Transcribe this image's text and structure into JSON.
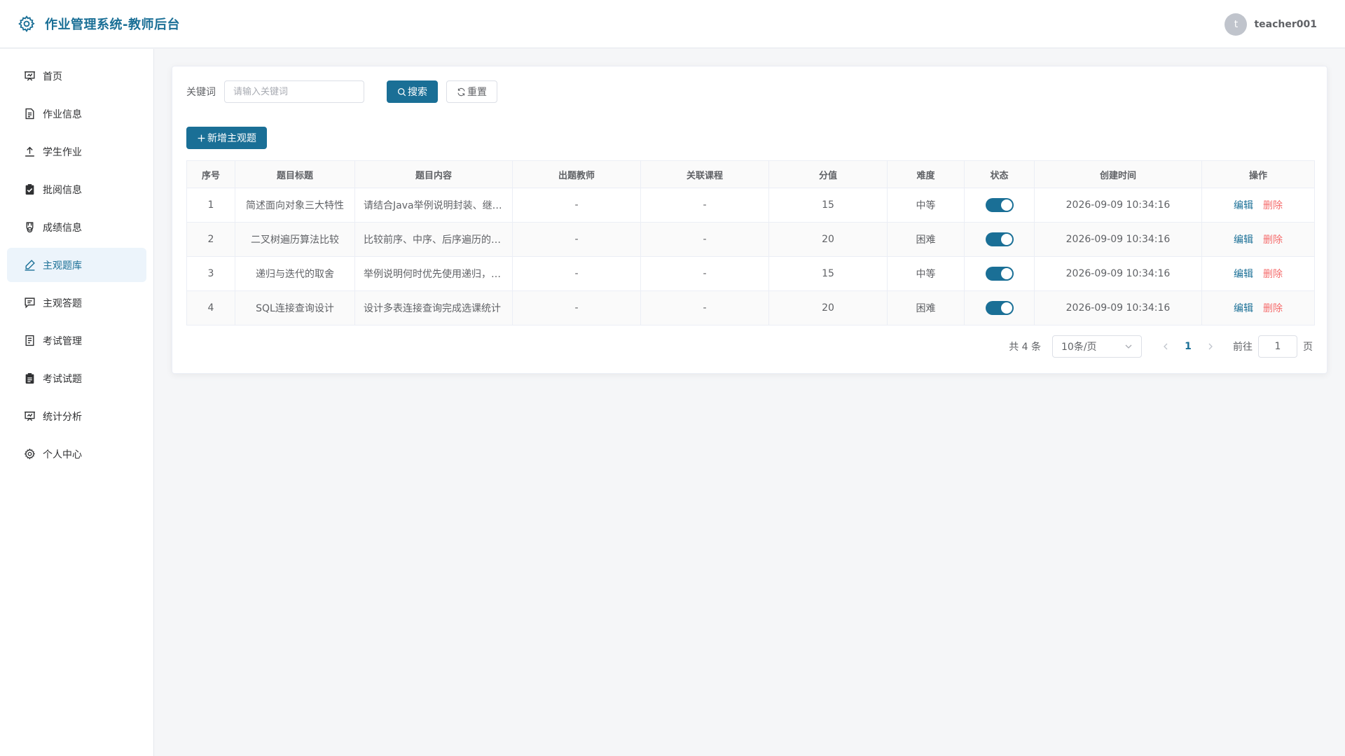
{
  "app": {
    "title": "作业管理系统-教师后台"
  },
  "user": {
    "avatar_letter": "t",
    "name": "teacher001"
  },
  "sidebar": {
    "items": [
      {
        "label": "首页",
        "icon": "dashboard-icon"
      },
      {
        "label": "作业信息",
        "icon": "document-icon"
      },
      {
        "label": "学生作业",
        "icon": "upload-icon"
      },
      {
        "label": "批阅信息",
        "icon": "clipboard-check-icon"
      },
      {
        "label": "成绩信息",
        "icon": "medal-icon"
      },
      {
        "label": "主观题库",
        "icon": "edit-pen-icon",
        "active": true
      },
      {
        "label": "主观答题",
        "icon": "chat-square-icon"
      },
      {
        "label": "考试管理",
        "icon": "tickets-icon"
      },
      {
        "label": "考试试题",
        "icon": "clipboard-list-icon"
      },
      {
        "label": "统计分析",
        "icon": "presentation-chart-icon"
      },
      {
        "label": "个人中心",
        "icon": "gear-icon"
      }
    ]
  },
  "search": {
    "label": "关键词",
    "placeholder": "请输入关键词",
    "search_label": "搜索",
    "reset_label": "重置"
  },
  "toolbar": {
    "add_label": "新增主观题"
  },
  "table": {
    "columns": [
      "序号",
      "题目标题",
      "题目内容",
      "出题教师",
      "关联课程",
      "分值",
      "难度",
      "状态",
      "创建时间",
      "操作"
    ],
    "rows": [
      {
        "index": "1",
        "title": "简述面向对象三大特性",
        "content": "请结合Java举例说明封装、继承、多态",
        "teacher": "-",
        "course": "-",
        "score": "15",
        "difficulty": "中等",
        "enabled": true,
        "created": "2026-09-09 10:34:16",
        "edit": "编辑",
        "delete": "删除"
      },
      {
        "index": "2",
        "title": "二叉树遍历算法比较",
        "content": "比较前序、中序、后序遍历的实现",
        "teacher": "-",
        "course": "-",
        "score": "20",
        "difficulty": "困难",
        "enabled": true,
        "created": "2026-09-09 10:34:16",
        "edit": "编辑",
        "delete": "删除"
      },
      {
        "index": "3",
        "title": "递归与迭代的取舍",
        "content": "举例说明何时优先使用递归，何时使用迭代",
        "teacher": "-",
        "course": "-",
        "score": "15",
        "difficulty": "中等",
        "enabled": true,
        "created": "2026-09-09 10:34:16",
        "edit": "编辑",
        "delete": "删除"
      },
      {
        "index": "4",
        "title": "SQL连接查询设计",
        "content": "设计多表连接查询完成选课统计",
        "teacher": "-",
        "course": "-",
        "score": "20",
        "difficulty": "困难",
        "enabled": true,
        "created": "2026-09-09 10:34:16",
        "edit": "编辑",
        "delete": "删除"
      }
    ]
  },
  "pagination": {
    "total": "共 4 条",
    "page_size": "10条/页",
    "current_page": "1",
    "goto_label": "前往",
    "goto_value": "1",
    "page_suffix": "页"
  },
  "colors": {
    "primary": "#1a6f96",
    "danger": "#f56c6c",
    "active_bg": "#ecf4fb"
  }
}
